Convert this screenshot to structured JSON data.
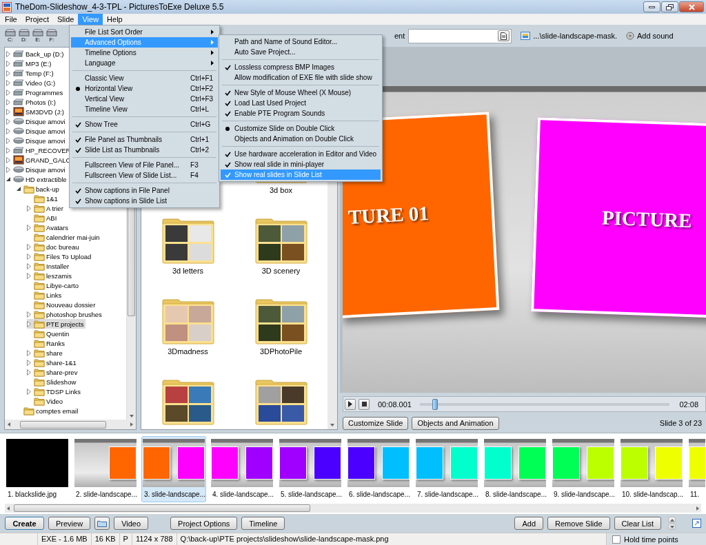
{
  "window": {
    "title": "TheDom-Slideshow_4-3-TPL - PicturesToExe Deluxe 5.5"
  },
  "menu_bar": [
    {
      "label": "File",
      "selected": false
    },
    {
      "label": "Project",
      "selected": false
    },
    {
      "label": "Slide",
      "selected": false
    },
    {
      "label": "View",
      "selected": true
    },
    {
      "label": "Help",
      "selected": false
    }
  ],
  "toolbar": {
    "drives": [
      "C:",
      "D:",
      "E:",
      "F:"
    ],
    "comment_label": "ent",
    "image_file": "...\\slide-landscape-mask.",
    "add_sound": "Add sound"
  },
  "tree": [
    {
      "label": "Back_up (D:)",
      "kind": "drive",
      "expanded": false,
      "selected": false
    },
    {
      "label": "MP3 (E:)",
      "kind": "drive",
      "expanded": false,
      "selected": false
    },
    {
      "label": "Temp (F:)",
      "kind": "drive",
      "expanded": false,
      "selected": false
    },
    {
      "label": "Video (G:)",
      "kind": "drive",
      "expanded": false,
      "selected": false
    },
    {
      "label": "Programmes",
      "kind": "drive",
      "expanded": false,
      "selected": false
    },
    {
      "label": "Photos (I:)",
      "kind": "drive",
      "expanded": false,
      "selected": false
    },
    {
      "label": "SM3DVD (J:)",
      "kind": "media",
      "expanded": false,
      "selected": false
    },
    {
      "label": "Disque amovi",
      "kind": "removable",
      "expanded": false,
      "selected": false
    },
    {
      "label": "Disque amovi",
      "kind": "removable",
      "expanded": false,
      "selected": false
    },
    {
      "label": "Disque amovi",
      "kind": "removable",
      "expanded": false,
      "selected": false
    },
    {
      "label": "HP_RECOVER",
      "kind": "drive",
      "expanded": false,
      "selected": false
    },
    {
      "label": "GRAND_GALC",
      "kind": "media",
      "expanded": false,
      "selected": false
    },
    {
      "label": "Disque amovi",
      "kind": "removable",
      "expanded": false,
      "selected": false
    },
    {
      "label": "HD extractible",
      "kind": "removable",
      "expanded": true,
      "selected": false,
      "children": [
        {
          "label": "back-up",
          "kind": "folder",
          "expanded": true,
          "selected": false,
          "children": [
            {
              "label": "1&1",
              "kind": "folder",
              "selected": false
            },
            {
              "label": "A trier",
              "kind": "folder",
              "expanded": false,
              "selected": false
            },
            {
              "label": "ABI",
              "kind": "folder",
              "selected": false
            },
            {
              "label": "Avatars",
              "kind": "folder",
              "expanded": false,
              "selected": false
            },
            {
              "label": "calendrier mai-juin",
              "kind": "folder",
              "selected": false
            },
            {
              "label": "doc bureau",
              "kind": "folder",
              "expanded": false,
              "selected": false
            },
            {
              "label": "Files To Upload",
              "kind": "folder",
              "expanded": false,
              "selected": false
            },
            {
              "label": "Installer",
              "kind": "folder",
              "expanded": false,
              "selected": false
            },
            {
              "label": "leszamis",
              "kind": "folder",
              "expanded": false,
              "selected": false
            },
            {
              "label": "Libye-carto",
              "kind": "folder",
              "selected": false
            },
            {
              "label": "Links",
              "kind": "folder",
              "selected": false
            },
            {
              "label": "Nouveau dossier",
              "kind": "folder",
              "selected": false
            },
            {
              "label": "photoshop brushes",
              "kind": "folder",
              "expanded": false,
              "selected": false
            },
            {
              "label": "PTE projects",
              "kind": "folder",
              "expanded": false,
              "selected": true
            },
            {
              "label": "Quentin",
              "kind": "folder",
              "selected": false
            },
            {
              "label": "Ranks",
              "kind": "folder",
              "selected": false
            },
            {
              "label": "share",
              "kind": "folder",
              "expanded": false,
              "selected": false
            },
            {
              "label": "share-1&1",
              "kind": "folder",
              "expanded": false,
              "selected": false
            },
            {
              "label": "share-prev",
              "kind": "folder",
              "expanded": false,
              "selected": false
            },
            {
              "label": "Slideshow",
              "kind": "folder",
              "selected": false
            },
            {
              "label": "TDSP Links",
              "kind": "folder",
              "expanded": false,
              "selected": false
            },
            {
              "label": "Video",
              "kind": "folder",
              "selected": false
            }
          ]
        },
        {
          "label": "comptes email",
          "kind": "folder",
          "selected": false
        }
      ]
    }
  ],
  "file_panel": {
    "items": [
      {
        "label": "3d box",
        "kind": "photos"
      },
      {
        "label": "3d letters",
        "kind": "letters"
      },
      {
        "label": "3D scenery",
        "kind": "photos"
      },
      {
        "label": "3Dmadness",
        "kind": "portraits"
      },
      {
        "label": "3DPhotoPile",
        "kind": "photos"
      },
      {
        "kind": "landscapes"
      },
      {
        "kind": "mixed"
      }
    ]
  },
  "preview": {
    "slide": [
      {
        "text": "TURE 01",
        "color": "#ff6600"
      },
      {
        "text": "PICTURE",
        "color": "#ff00ff"
      }
    ],
    "player": {
      "time": "00:08.001",
      "level": 0.06,
      "duration": "02:08"
    },
    "buttons": [
      "Customize Slide",
      "Objects and Animation"
    ],
    "slide_counter": "Slide 3 of 23"
  },
  "slide_list": {
    "items": [
      {
        "caption": "1. blackslide.jpg",
        "kind": "plain",
        "color": "#000000",
        "selected": false
      },
      {
        "caption": "2. slide-landscape...",
        "kind": "template",
        "selected": false,
        "squares": [
          {
            "color": "#ff6600",
            "kind": "right"
          }
        ]
      },
      {
        "caption": "3. slide-landscape...",
        "kind": "template",
        "selected": true,
        "squares": [
          {
            "color": "#ff6600",
            "kind": "left"
          },
          {
            "color": "#ff00ff",
            "kind": "right"
          }
        ]
      },
      {
        "caption": "4. slide-landscape...",
        "kind": "template",
        "selected": false,
        "squares": [
          {
            "color": "#ff00ff",
            "kind": "left"
          },
          {
            "color": "#a000ff",
            "kind": "right"
          }
        ]
      },
      {
        "caption": "5. slide-landscape...",
        "kind": "template",
        "selected": false,
        "squares": [
          {
            "color": "#a000ff",
            "kind": "left"
          },
          {
            "color": "#4b00ff",
            "kind": "right"
          }
        ]
      },
      {
        "caption": "6. slide-landscape...",
        "kind": "template",
        "selected": false,
        "squares": [
          {
            "color": "#4b00ff",
            "kind": "left"
          },
          {
            "color": "#00bfff",
            "kind": "right"
          }
        ]
      },
      {
        "caption": "7. slide-landscape...",
        "kind": "template",
        "selected": false,
        "squares": [
          {
            "color": "#00bfff",
            "kind": "left"
          },
          {
            "color": "#00ffcc",
            "kind": "right"
          }
        ]
      },
      {
        "caption": "8. slide-landscape...",
        "kind": "template",
        "selected": false,
        "squares": [
          {
            "color": "#00ffcc",
            "kind": "left"
          },
          {
            "color": "#00ff55",
            "kind": "right"
          }
        ]
      },
      {
        "caption": "9. slide-landscape...",
        "kind": "template",
        "selected": false,
        "squares": [
          {
            "color": "#00ff55",
            "kind": "left"
          },
          {
            "color": "#bbff00",
            "kind": "right"
          }
        ]
      },
      {
        "caption": "10. slide-landscap...",
        "kind": "template",
        "selected": false,
        "squares": [
          {
            "color": "#bbff00",
            "kind": "left"
          },
          {
            "color": "#eeff00",
            "kind": "right"
          }
        ]
      },
      {
        "caption": "11.",
        "kind": "template",
        "selected": false,
        "squares": [
          {
            "color": "#eeff00",
            "kind": "left"
          }
        ]
      }
    ]
  },
  "actions_left": [
    {
      "kind": "text",
      "label": "Create",
      "default": true
    },
    {
      "kind": "text",
      "label": "Preview",
      "default": false
    },
    {
      "kind": "icon"
    },
    {
      "kind": "text",
      "label": "Video",
      "default": false
    },
    {
      "kind": "text",
      "label": "Project Options",
      "default": false
    },
    {
      "kind": "text",
      "label": "Timeline",
      "default": false
    }
  ],
  "actions_right": [
    {
      "kind": "text",
      "label": "Add",
      "default": false
    },
    {
      "kind": "text",
      "label": "Remove Slide",
      "default": false
    },
    {
      "kind": "text",
      "label": "Clear List",
      "default": false
    }
  ],
  "status_bar": {
    "cells": [
      "EXE - 1.6 MB",
      "16 KB",
      "P",
      "1124 x 788",
      "Q:\\back-up\\PTE projects\\slideshow\\slide-landscape-mask.png"
    ],
    "hold_time_points": {
      "label": "Hold time points",
      "checked": false
    }
  },
  "view_menu": {
    "items": [
      {
        "kind": "submenu",
        "label": "File List Sort Order",
        "selected": false
      },
      {
        "kind": "submenu",
        "label": "Advanced Options",
        "selected": true
      },
      {
        "kind": "submenu",
        "label": "Timeline Options",
        "selected": false
      },
      {
        "kind": "submenu",
        "label": "Language",
        "selected": false
      },
      {
        "kind": "separator"
      },
      {
        "kind": "radio",
        "label": "Classic View",
        "shortcut": "Ctrl+F1",
        "checked": false,
        "selected": false
      },
      {
        "kind": "radio",
        "label": "Horizontal View",
        "shortcut": "Ctrl+F2",
        "checked": true,
        "selected": false
      },
      {
        "kind": "radio",
        "label": "Vertical View",
        "shortcut": "Ctrl+F3",
        "checked": false,
        "selected": false
      },
      {
        "kind": "radio",
        "label": "Timeline View",
        "shortcut": "Ctrl+L",
        "checked": false,
        "selected": false
      },
      {
        "kind": "separator"
      },
      {
        "kind": "check",
        "label": "Show Tree",
        "shortcut": "Ctrl+G",
        "checked": true,
        "selected": false
      },
      {
        "kind": "separator"
      },
      {
        "kind": "check",
        "label": "File Panel as Thumbnails",
        "shortcut": "Ctrl+1",
        "checked": true,
        "selected": false
      },
      {
        "kind": "check",
        "label": "Slide List as Thumbnails",
        "shortcut": "Ctrl+2",
        "checked": true,
        "selected": false
      },
      {
        "kind": "separator"
      },
      {
        "kind": "item",
        "label": "Fullscreen View of File Panel...",
        "shortcut": "F3",
        "selected": false
      },
      {
        "kind": "item",
        "label": "Fullscreen View of Slide List...",
        "shortcut": "F4",
        "selected": false
      },
      {
        "kind": "separator"
      },
      {
        "kind": "check",
        "label": "Show captions in File Panel",
        "checked": true,
        "selected": false
      },
      {
        "kind": "check",
        "label": "Show captions in Slide List",
        "checked": true,
        "selected": false
      }
    ]
  },
  "advanced_submenu": {
    "items": [
      {
        "kind": "item",
        "label": "Path and Name of Sound Editor...",
        "selected": false
      },
      {
        "kind": "item",
        "label": "Auto Save Project...",
        "selected": false
      },
      {
        "kind": "separator"
      },
      {
        "kind": "check",
        "label": "Lossless compress BMP Images",
        "checked": true,
        "selected": false
      },
      {
        "kind": "check",
        "label": "Allow modification of EXE file with slide show",
        "checked": false,
        "selected": false
      },
      {
        "kind": "separator"
      },
      {
        "kind": "check",
        "label": "New Style of Mouse Wheel (X Mouse)",
        "checked": true,
        "selected": false
      },
      {
        "kind": "check",
        "label": "Load Last Used Project",
        "checked": true,
        "selected": false
      },
      {
        "kind": "check",
        "label": "Enable PTE Program Sounds",
        "checked": true,
        "selected": false
      },
      {
        "kind": "separator"
      },
      {
        "kind": "radio",
        "label": "Customize Slide on Double Click",
        "checked": true,
        "selected": false
      },
      {
        "kind": "radio",
        "label": "Objects and Animation on Double Click",
        "checked": false,
        "selected": false
      },
      {
        "kind": "separator"
      },
      {
        "kind": "check",
        "label": "Use hardware acceleration in Editor and Video",
        "checked": true,
        "selected": false
      },
      {
        "kind": "check",
        "label": "Show real slide in mini-player",
        "checked": true,
        "selected": false
      },
      {
        "kind": "check",
        "label": "Show real slides in Slide List",
        "checked": true,
        "selected": true
      }
    ]
  }
}
